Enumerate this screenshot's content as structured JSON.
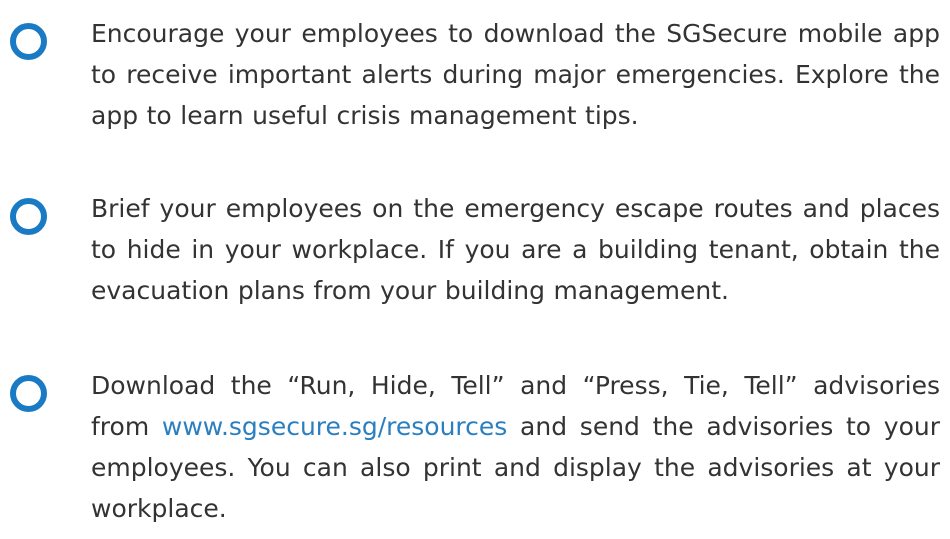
{
  "accent_color": "#1a7bc4",
  "link_color": "#2a7fc1",
  "bullet_icon": "circle-outline-icon",
  "items": [
    {
      "text": "Encourage your employees to download the SGSecure mobile app to receive important alerts during major emergencies. Explore the app to learn useful crisis management tips."
    },
    {
      "text": "Brief your employees on the emergency escape routes and places to hide in your workplace. If you are a building tenant, obtain the evacuation plans from your building management."
    },
    {
      "text_before": "Download the “Run, Hide, Tell” and “Press, Tie, Tell” advisories from ",
      "link": "www.sgsecure.sg/resources",
      "text_after": " and send the advisories to your employees. You can also print and display the advisories at your workplace."
    }
  ]
}
